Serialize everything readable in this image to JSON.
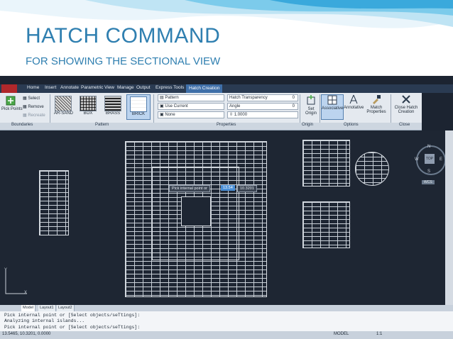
{
  "slide": {
    "title": "HATCH COMMAND",
    "subtitle": "FOR SHOWING THE SECTIONAL VIEW"
  },
  "menu": {
    "tabs": [
      "Home",
      "Insert",
      "Annotate",
      "Parametric",
      "View",
      "Manage",
      "Output",
      "Express Tools",
      "Hatch Creation"
    ],
    "active_tab": "Hatch Creation"
  },
  "ribbon": {
    "boundaries": {
      "pick_points": "Pick Points",
      "select": "Select",
      "remove": "Remove",
      "recreate": "Recreate",
      "label": "Boundaries"
    },
    "pattern": {
      "swatches": [
        "AR-SAND",
        "BOX",
        "BRASS",
        "BRICK"
      ],
      "selected": "BRICK",
      "label": "Pattern"
    },
    "properties": {
      "type": "Pattern",
      "color": "Use Current",
      "background": "None",
      "transparency_label": "Hatch Transparency",
      "transparency_value": "0",
      "angle_label": "Angle",
      "angle_value": "0",
      "scale_value": "1.0000",
      "label": "Properties"
    },
    "origin": {
      "set_origin": "Set Origin",
      "label": "Origin"
    },
    "options": {
      "associative": "Associative",
      "annotative": "Annotative",
      "match_properties": "Match Properties",
      "label": "Options"
    },
    "close": {
      "close_hatch": "Close Hatch Creation",
      "label": "Close"
    }
  },
  "canvas": {
    "tooltip_prompt": "Pick internal point or",
    "tooltip_x": "13.54",
    "tooltip_y": "10.3201",
    "viewcube_top": "TOP",
    "compass": {
      "n": "N",
      "s": "S",
      "e": "E",
      "w": "W"
    },
    "wcs": "WCS",
    "axis_x": "X",
    "axis_y": "Y"
  },
  "layout_tabs": [
    "Model",
    "Layout1",
    "Layout2"
  ],
  "command_line": {
    "lines": [
      "Pick internal point or [Select objects/seTtings]:",
      "Analyzing internal islands...",
      "Pick internal point or [Select objects/seTtings]:"
    ]
  },
  "status": {
    "coords": "13.5465, 10.3201, 0.0000",
    "model": "MODEL",
    "scale": "1:1"
  },
  "colors": {
    "title_blue": "#2f7fb0",
    "canvas_bg": "#1e2633",
    "ribbon_bg": "#e4e9ef"
  }
}
